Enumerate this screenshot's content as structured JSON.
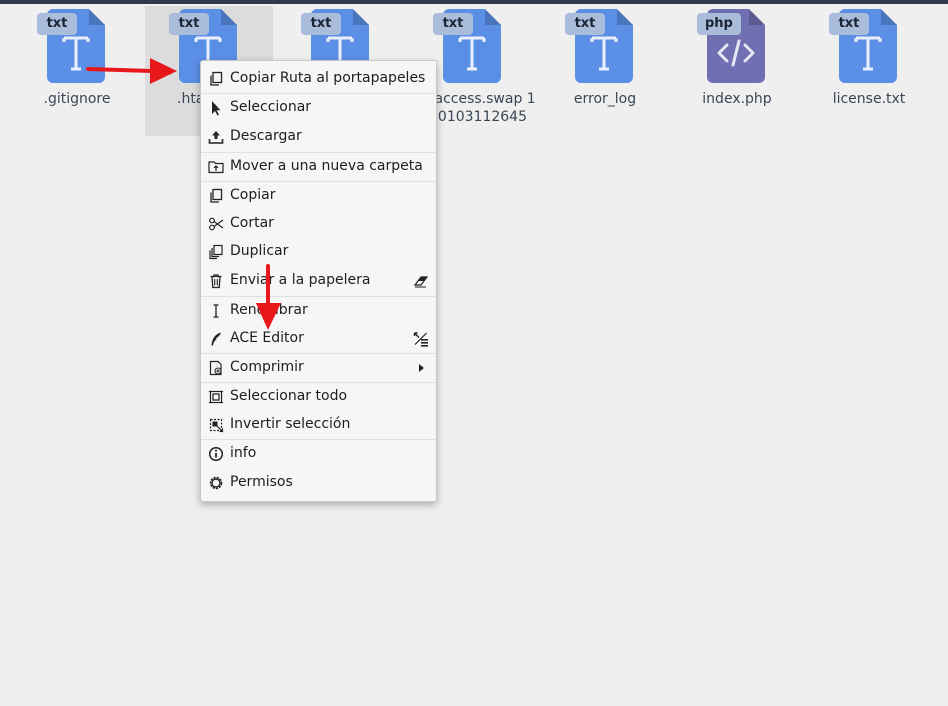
{
  "files": [
    {
      "badge": "txt",
      "name": ".gitignore",
      "type": "txt"
    },
    {
      "badge": "txt",
      "name": ".hta",
      "type": "txt",
      "selected": true
    },
    {
      "badge": "txt",
      "name": "",
      "type": "txt"
    },
    {
      "badge": "txt",
      "name": "taccess.swap 180103112645",
      "type": "txt"
    },
    {
      "badge": "txt",
      "name": "error_log",
      "type": "txt"
    },
    {
      "badge": "php",
      "name": "index.php",
      "type": "php"
    },
    {
      "badge": "txt",
      "name": "license.txt",
      "type": "txt"
    }
  ],
  "context_menu": {
    "copy_path": "Copiar Ruta al portapapeles",
    "select": "Seleccionar",
    "download": "Descargar",
    "move_new_folder": "Mover a una nueva carpeta",
    "copy": "Copiar",
    "cut": "Cortar",
    "duplicate": "Duplicar",
    "trash": "Enviar a la papelera",
    "rename": "Renombrar",
    "ace_editor": "ACE Editor",
    "compress": "Comprimir",
    "select_all": "Seleccionar todo",
    "invert_selection": "Invertir selección",
    "info": "info",
    "permissions": "Permisos"
  },
  "colors": {
    "txt_icon": "#5b8fe6",
    "php_icon": "#6f6fb1",
    "annotation_arrow": "#e8181a",
    "top_bar": "#303a4a"
  }
}
